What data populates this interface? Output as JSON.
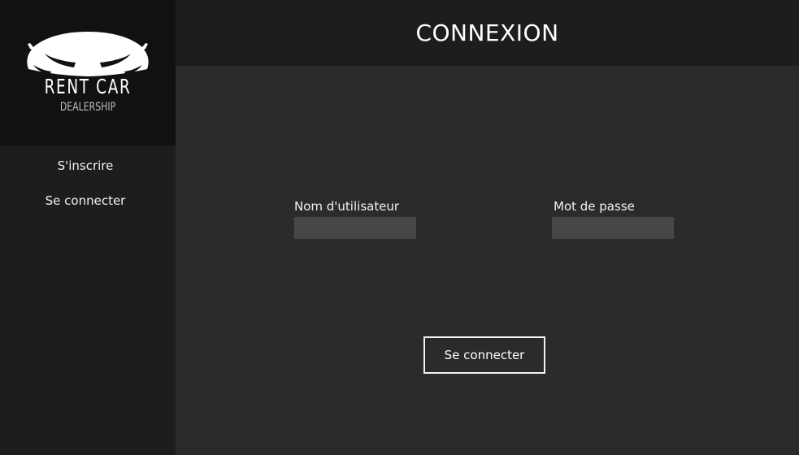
{
  "brand": {
    "name": "RENT CAR",
    "subtitle": "DEALERSHIP",
    "logo_icon": "car-icon"
  },
  "sidebar": {
    "items": [
      {
        "label": "S'inscrire"
      },
      {
        "label": "Se connecter"
      }
    ]
  },
  "header": {
    "title": "CONNEXION"
  },
  "form": {
    "username_label": "Nom d'utilisateur",
    "username_value": "",
    "password_label": "Mot de passe",
    "password_value": "",
    "submit_label": "Se connecter"
  },
  "colors": {
    "sidebar_bg": "#1d1d1d",
    "logo_bg": "#111111",
    "main_bg": "#2b2b2b",
    "input_bg": "#474747",
    "text": "#ffffff"
  }
}
